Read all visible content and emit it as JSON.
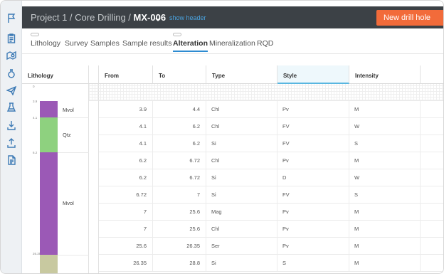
{
  "header": {
    "breadcrumb_project": "Project 1",
    "breadcrumb_sep1": " / ",
    "breadcrumb_section": "Core Drilling",
    "breadcrumb_sep2": " / ",
    "hole_id": "MX-006",
    "show_header": "show header",
    "new_button": "New drill hole"
  },
  "tabs": [
    "Lithology",
    "Survey",
    "Samples",
    "Sample results",
    "Alteration",
    "Mineralization",
    "RQD"
  ],
  "active_tab": "Alteration",
  "columns": {
    "lithology": "Lithology",
    "from": "From",
    "to": "To",
    "type": "Type",
    "style": "Style",
    "intensity": "Intensity"
  },
  "lithology": {
    "scale_labels": [
      "0",
      "3.9",
      "4.1",
      "6.2",
      "26.35"
    ],
    "units": [
      {
        "label": "Mvol",
        "color": "#9b59b6",
        "from": 3.9,
        "to": 4.1
      },
      {
        "label": "Qtz",
        "color": "#8ed17f",
        "from": 4.1,
        "to": 6.2
      },
      {
        "label": "Mvol",
        "color": "#9b59b6",
        "from": 6.2,
        "to": 26.35
      },
      {
        "label": "",
        "color": "#c8c9a0",
        "from": 26.35,
        "to": 28.8
      }
    ]
  },
  "rows": [
    {
      "from": "3.9",
      "to": "4.4",
      "type": "Chl",
      "style": "Pv",
      "intensity": "M"
    },
    {
      "from": "4.1",
      "to": "6.2",
      "type": "Chl",
      "style": "FV",
      "intensity": "W"
    },
    {
      "from": "4.1",
      "to": "6.2",
      "type": "Si",
      "style": "FV",
      "intensity": "S"
    },
    {
      "from": "6.2",
      "to": "6.72",
      "type": "Chl",
      "style": "Pv",
      "intensity": "M"
    },
    {
      "from": "6.2",
      "to": "6.72",
      "type": "Si",
      "style": "D",
      "intensity": "W"
    },
    {
      "from": "6.72",
      "to": "7",
      "type": "Si",
      "style": "FV",
      "intensity": "S"
    },
    {
      "from": "7",
      "to": "25.6",
      "type": "Mag",
      "style": "Pv",
      "intensity": "M"
    },
    {
      "from": "7",
      "to": "25.6",
      "type": "Chl",
      "style": "Pv",
      "intensity": "M"
    },
    {
      "from": "25.6",
      "to": "26.35",
      "type": "Ser",
      "style": "Pv",
      "intensity": "M"
    },
    {
      "from": "26.35",
      "to": "28.8",
      "type": "Si",
      "style": "S",
      "intensity": "M"
    }
  ],
  "icons": [
    "flag-icon",
    "clipboard-icon",
    "map-icon",
    "flask-bottle-icon",
    "send-icon",
    "beaker-icon",
    "download-icon",
    "upload-icon",
    "document-icon"
  ],
  "colors": {
    "accent": "#f26b3a",
    "header_bg": "#3c4146",
    "link": "#4aa3df",
    "tab_underline": "#2d8bd1",
    "icon": "#3d7ab5"
  }
}
